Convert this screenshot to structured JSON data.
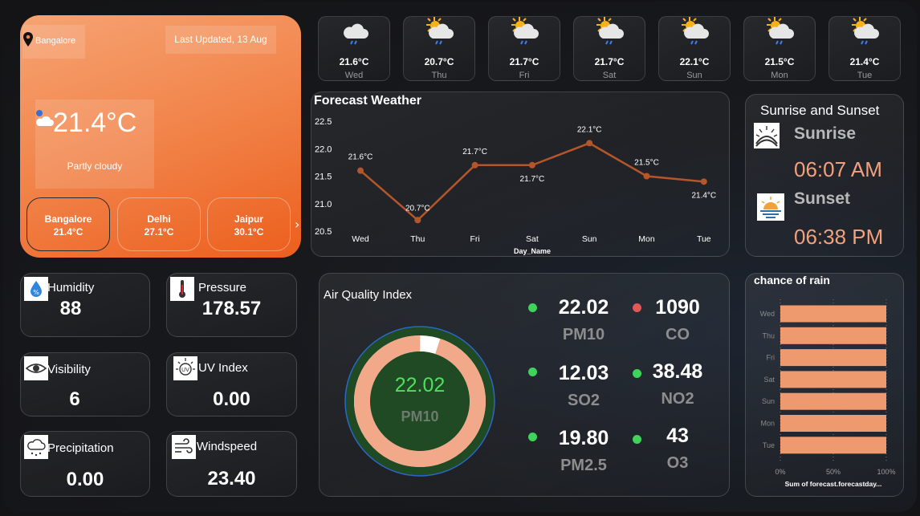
{
  "main": {
    "location": "Bangalore",
    "last_updated": "Last Updated, 13 Aug",
    "temperature": "21.4°C",
    "condition": "Partly cloudy",
    "cities": [
      {
        "name": "Bangalore",
        "temp": "21.4°C"
      },
      {
        "name": "Delhi",
        "temp": "27.1°C"
      },
      {
        "name": "Jaipur",
        "temp": "30.1°C"
      }
    ],
    "next_arrow": "›"
  },
  "days": [
    {
      "temp": "21.6°C",
      "name": "Wed",
      "icon": "rain-cloud-icon"
    },
    {
      "temp": "20.7°C",
      "name": "Thu",
      "icon": "sun-rain-cloud-icon"
    },
    {
      "temp": "21.7°C",
      "name": "Fri",
      "icon": "sun-rain-cloud-icon"
    },
    {
      "temp": "21.7°C",
      "name": "Sat",
      "icon": "sun-rain-cloud-icon"
    },
    {
      "temp": "22.1°C",
      "name": "Sun",
      "icon": "sun-rain-cloud-icon"
    },
    {
      "temp": "21.5°C",
      "name": "Mon",
      "icon": "sun-rain-cloud-icon"
    },
    {
      "temp": "21.4°C",
      "name": "Tue",
      "icon": "sun-rain-cloud-icon"
    }
  ],
  "forecast": {
    "title": "Forecast Weather",
    "xlabel": "Day_Name"
  },
  "sun": {
    "title": "Sunrise and Sunset",
    "sunrise_label": "Sunrise",
    "sunrise_time": "06:07 AM",
    "sunset_label": "Sunset",
    "sunset_time": "06:38 PM"
  },
  "metrics": [
    {
      "label": "Humidity",
      "value": "88",
      "icon": "humidity-icon"
    },
    {
      "label": "Pressure",
      "value": "178.57",
      "icon": "thermometer-icon"
    },
    {
      "label": "Visibility",
      "value": "6",
      "icon": "eye-icon"
    },
    {
      "label": "UV Index",
      "value": "0.00",
      "icon": "uv-sun-icon"
    },
    {
      "label": "Precipitation",
      "value": "0.00",
      "icon": "rain-cloud-icon"
    },
    {
      "label": "Windspeed",
      "value": "23.40",
      "icon": "wind-icon"
    }
  ],
  "aqi": {
    "title": "Air Quality Index",
    "gauge_value": "22.02",
    "gauge_label": "PM10",
    "gauge_fraction": 0.95,
    "items": [
      {
        "value": "22.02",
        "key": "PM10",
        "status": "green"
      },
      {
        "value": "1090",
        "key": "CO",
        "status": "red"
      },
      {
        "value": "12.03",
        "key": "SO2",
        "status": "green"
      },
      {
        "value": "38.48",
        "key": "NO2",
        "status": "green"
      },
      {
        "value": "19.80",
        "key": "PM2.5",
        "status": "green"
      },
      {
        "value": "43",
        "key": "O3",
        "status": "green"
      }
    ]
  },
  "colors": {
    "accent_orange": "#f07a3c",
    "line_brown": "#b5562a",
    "bar_salmon": "#ef9a6e",
    "gauge_ring": "#f2a98a",
    "gauge_center": "#1f4a23",
    "good": "#3ed35a",
    "bad": "#e05858",
    "sun_time": "#f3a07c"
  },
  "chart_data": [
    {
      "type": "line",
      "title": "Forecast Weather",
      "xlabel": "Day_Name",
      "ylabel": "",
      "categories": [
        "Wed",
        "Thu",
        "Fri",
        "Sat",
        "Sun",
        "Mon",
        "Tue"
      ],
      "values": [
        21.6,
        20.7,
        21.7,
        21.7,
        22.1,
        21.5,
        21.4
      ],
      "data_labels": [
        "21.6°C",
        "20.7°C",
        "21.7°C",
        "21.7°C",
        "22.1°C",
        "21.5°C",
        "21.4°C"
      ],
      "yticks": [
        "22.5",
        "22.0",
        "21.5",
        "21.0",
        "20.5"
      ],
      "ylim": [
        20.5,
        22.5
      ]
    },
    {
      "type": "bar",
      "orientation": "horizontal",
      "title": "chance of rain",
      "xlabel": "Sum of forecast.forecastday...",
      "categories": [
        "Wed",
        "Thu",
        "Fri",
        "Sat",
        "Sun",
        "Mon",
        "Tue"
      ],
      "values": [
        100,
        100,
        100,
        100,
        100,
        100,
        100
      ],
      "xticks": [
        "0%",
        "50%",
        "100%"
      ],
      "xlim": [
        0,
        100
      ]
    }
  ]
}
